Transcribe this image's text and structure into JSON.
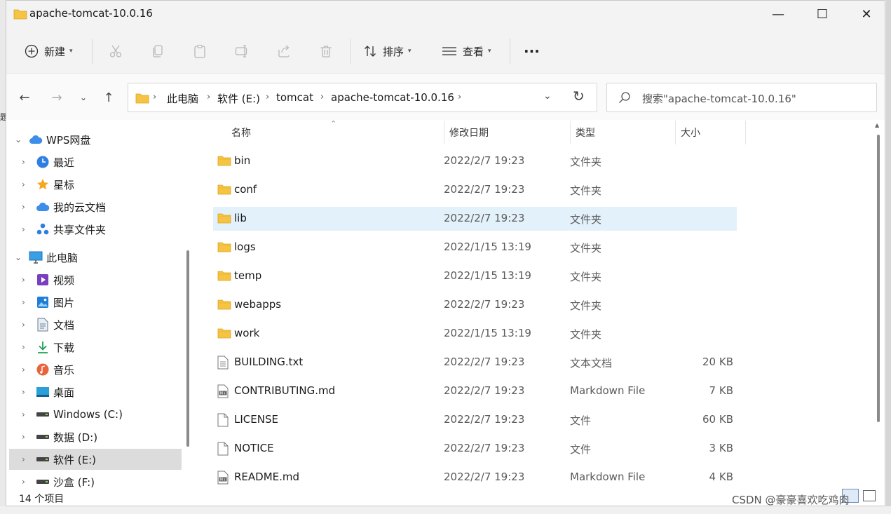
{
  "window": {
    "title": "apache-tomcat-10.0.16",
    "minimize_glyph": "—",
    "maximize_glyph": "☐",
    "close_glyph": "✕"
  },
  "toolbar": {
    "new_label": "新建",
    "sort_label": "排序",
    "view_label": "查看",
    "more_glyph": "···"
  },
  "address": {
    "crumbs": [
      "此电脑",
      "软件 (E:)",
      "tomcat",
      "apache-tomcat-10.0.16"
    ],
    "search_placeholder": "搜索\"apache-tomcat-10.0.16\""
  },
  "sidebar": {
    "items": [
      {
        "label": "WPS网盘",
        "icon": "cloud-icon",
        "level": 0
      },
      {
        "label": "最近",
        "icon": "clock-icon",
        "level": 1
      },
      {
        "label": "星标",
        "icon": "star-icon",
        "level": 1
      },
      {
        "label": "我的云文档",
        "icon": "cloud-icon",
        "level": 1
      },
      {
        "label": "共享文件夹",
        "icon": "share-icon",
        "level": 1
      },
      {
        "label": "此电脑",
        "icon": "monitor-icon",
        "level": 0
      },
      {
        "label": "视频",
        "icon": "video-icon",
        "level": 1
      },
      {
        "label": "图片",
        "icon": "image-icon",
        "level": 1
      },
      {
        "label": "文档",
        "icon": "document-icon",
        "level": 1
      },
      {
        "label": "下载",
        "icon": "download-icon",
        "level": 1
      },
      {
        "label": "音乐",
        "icon": "music-icon",
        "level": 1
      },
      {
        "label": "桌面",
        "icon": "desktop-icon",
        "level": 1
      },
      {
        "label": "Windows (C:)",
        "icon": "drive-icon",
        "level": 1
      },
      {
        "label": "数据 (D:)",
        "icon": "drive-icon",
        "level": 1
      },
      {
        "label": "软件 (E:)",
        "icon": "drive-icon",
        "level": 1,
        "selected": true
      },
      {
        "label": "沙盒 (F:)",
        "icon": "drive-icon",
        "level": 1
      }
    ]
  },
  "columns": {
    "name": "名称",
    "date": "修改日期",
    "type": "类型",
    "size": "大小"
  },
  "files": [
    {
      "name": "bin",
      "date": "2022/2/7 19:23",
      "type": "文件夹",
      "size": "",
      "icon": "folder-icon"
    },
    {
      "name": "conf",
      "date": "2022/2/7 19:23",
      "type": "文件夹",
      "size": "",
      "icon": "folder-icon"
    },
    {
      "name": "lib",
      "date": "2022/2/7 19:23",
      "type": "文件夹",
      "size": "",
      "icon": "folder-icon",
      "selected": true
    },
    {
      "name": "logs",
      "date": "2022/1/15 13:19",
      "type": "文件夹",
      "size": "",
      "icon": "folder-icon"
    },
    {
      "name": "temp",
      "date": "2022/1/15 13:19",
      "type": "文件夹",
      "size": "",
      "icon": "folder-icon"
    },
    {
      "name": "webapps",
      "date": "2022/2/7 19:23",
      "type": "文件夹",
      "size": "",
      "icon": "folder-icon"
    },
    {
      "name": "work",
      "date": "2022/1/15 13:19",
      "type": "文件夹",
      "size": "",
      "icon": "folder-icon"
    },
    {
      "name": "BUILDING.txt",
      "date": "2022/2/7 19:23",
      "type": "文本文档",
      "size": "20 KB",
      "icon": "text-file-icon"
    },
    {
      "name": "CONTRIBUTING.md",
      "date": "2022/2/7 19:23",
      "type": "Markdown File",
      "size": "7 KB",
      "icon": "markdown-file-icon"
    },
    {
      "name": "LICENSE",
      "date": "2022/2/7 19:23",
      "type": "文件",
      "size": "60 KB",
      "icon": "file-icon"
    },
    {
      "name": "NOTICE",
      "date": "2022/2/7 19:23",
      "type": "文件",
      "size": "3 KB",
      "icon": "file-icon"
    },
    {
      "name": "README.md",
      "date": "2022/2/7 19:23",
      "type": "Markdown File",
      "size": "4 KB",
      "icon": "markdown-file-icon"
    }
  ],
  "status": {
    "item_count": "14 个项目"
  },
  "watermark": "CSDN @豪豪喜欢吃鸡肉",
  "colors": {
    "folder_yellow": "#f6c342",
    "selection_blue": "#e3f1fb",
    "sidebar_selected": "#dcdcdc"
  }
}
